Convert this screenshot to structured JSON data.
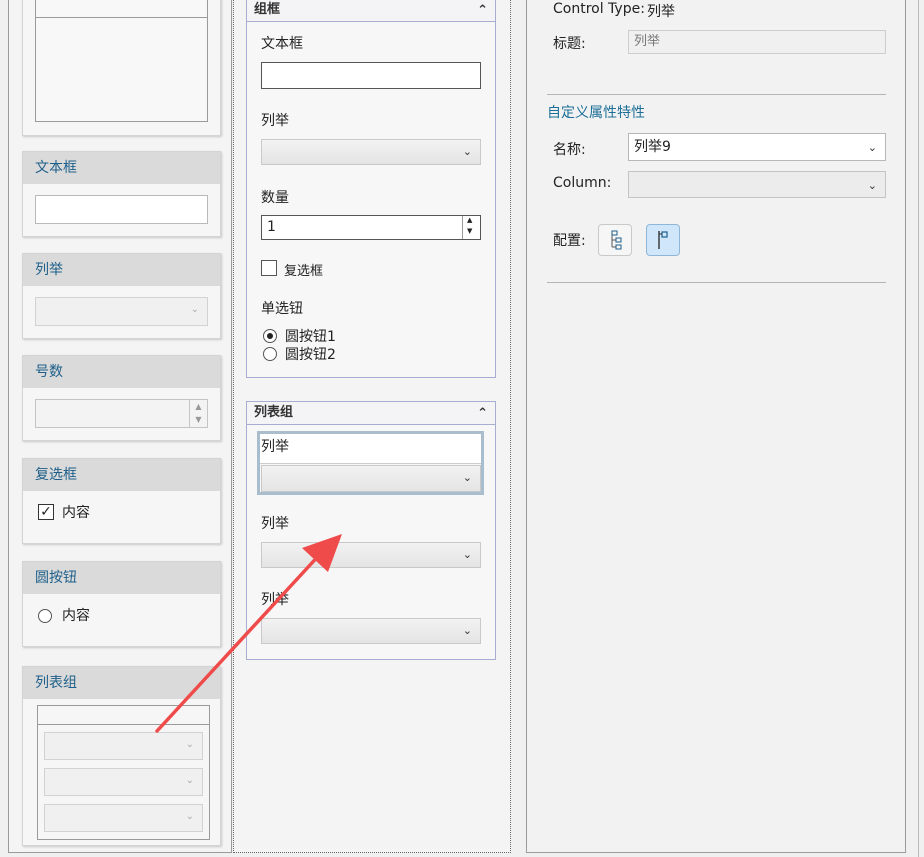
{
  "palette": {
    "cards": [
      {
        "title": ""
      },
      {
        "title": "文本框"
      },
      {
        "title": "列举"
      },
      {
        "title": "号数"
      },
      {
        "title": "复选框",
        "checkbox_label": "内容",
        "checked": true,
        "check_glyph": "✓"
      },
      {
        "title": "圆按钮",
        "radio_label": "内容"
      },
      {
        "title": "列表组"
      }
    ]
  },
  "form": {
    "group_box": {
      "title": "组框",
      "collapse_glyph": "⌃",
      "textbox_label": "文本框",
      "textbox_value": "",
      "enum_label": "列举",
      "quantity_label": "数量",
      "quantity_value": "1",
      "checkbox_label": "复选框",
      "checkbox_checked": false,
      "radio_group_label": "单选钮",
      "radios": [
        {
          "label": "圆按钮1",
          "selected": true
        },
        {
          "label": "圆按钮2",
          "selected": false
        }
      ]
    },
    "list_group": {
      "title": "列表组",
      "collapse_glyph": "⌃",
      "items": [
        {
          "label": "列举",
          "selected": true
        },
        {
          "label": "列举",
          "selected": false
        },
        {
          "label": "列举",
          "selected": false
        }
      ]
    },
    "chevron_glyph": "⌄",
    "spin_up_glyph": "▲",
    "spin_down_glyph": "▼"
  },
  "properties": {
    "control_type_label": "Control Type:",
    "control_type_value": "列举",
    "title_label": "标题:",
    "title_value": "列举",
    "custom_section_title": "自定义属性特性",
    "name_label": "名称:",
    "name_value": "列举9",
    "column_label": "Column:",
    "column_value": "",
    "config_label": "配置:",
    "config_buttons": [
      {
        "icon": "tree-icon",
        "active": false
      },
      {
        "icon": "flag-icon",
        "active": true
      }
    ]
  },
  "colors": {
    "accent": "#1d6f98",
    "annotation_arrow": "#ef4b4b"
  }
}
